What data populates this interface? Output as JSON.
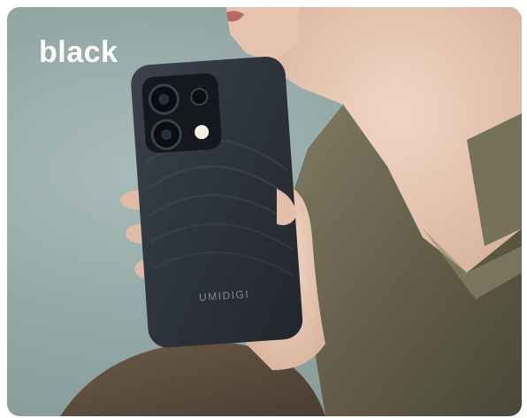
{
  "product": {
    "color_label": "black",
    "brand_text": "UMIDIGI"
  },
  "colors": {
    "background": "#93a8a5",
    "phone_body": "#2f353d",
    "jacket": "#6b6650",
    "skin": "#e8c8b4"
  }
}
